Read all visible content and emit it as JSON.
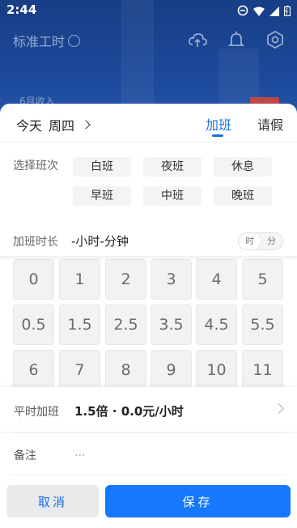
{
  "status_bar": {
    "time": "2:44",
    "icons": [
      "dnd-icon",
      "wifi-icon",
      "signal-icon",
      "battery-icon"
    ]
  },
  "app": {
    "title": "标准工时"
  },
  "background": {
    "month_income_label": "6月收入"
  },
  "sheet": {
    "date_label": "今天",
    "weekday": "周四",
    "tabs": [
      {
        "label": "加班",
        "active": true
      },
      {
        "label": "请假",
        "active": false
      }
    ],
    "shift": {
      "label": "选择班次",
      "options": [
        "白班",
        "夜班",
        "休息",
        "早班",
        "中班",
        "晚班"
      ]
    },
    "duration": {
      "label": "加班时长",
      "value": "-小时-分钟",
      "unit_toggle": [
        "时",
        "分"
      ],
      "unit_selected": "时"
    },
    "keypad": [
      "0",
      "1",
      "2",
      "3",
      "4",
      "5",
      "0.5",
      "1.5",
      "2.5",
      "3.5",
      "4.5",
      "5.5",
      "6",
      "7",
      "8",
      "9",
      "10",
      "11"
    ]
  },
  "bottom": {
    "overtime_label": "平时加班",
    "overtime_value": "1.5倍 · 0.0元/小时",
    "note_label": "备注",
    "note_placeholder": "...",
    "cancel_label": "取消",
    "save_label": "保存"
  },
  "colors": {
    "accent": "#1677ff",
    "header_bg": "#1c4a9c"
  }
}
